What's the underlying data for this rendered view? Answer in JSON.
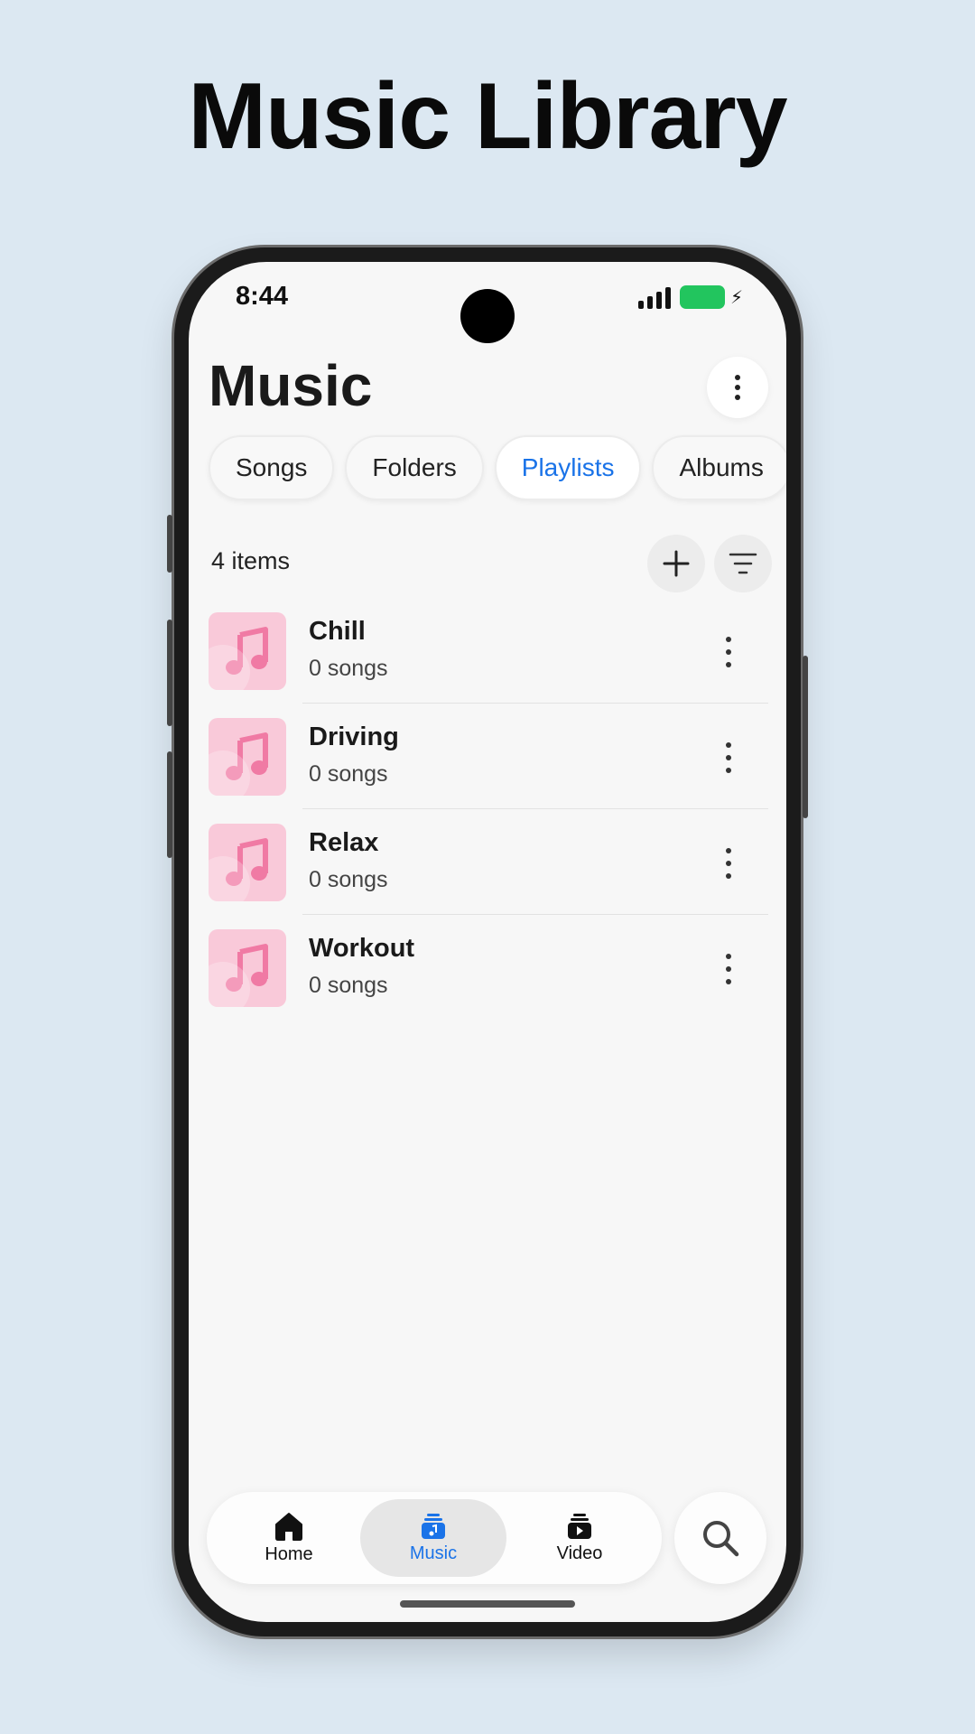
{
  "promo": {
    "title": "Music Library"
  },
  "status_bar": {
    "time": "8:44"
  },
  "header": {
    "title": "Music"
  },
  "tabs": [
    {
      "label": "Songs"
    },
    {
      "label": "Folders"
    },
    {
      "label": "Playlists",
      "active": true
    },
    {
      "label": "Albums"
    }
  ],
  "toolbar": {
    "count_label": "4 items"
  },
  "playlists": [
    {
      "name": "Chill",
      "subtitle": "0 songs"
    },
    {
      "name": "Driving",
      "subtitle": "0 songs"
    },
    {
      "name": "Relax",
      "subtitle": "0 songs"
    },
    {
      "name": "Workout",
      "subtitle": "0 songs"
    }
  ],
  "bottom_nav": {
    "items": [
      {
        "label": "Home",
        "icon": "home-icon"
      },
      {
        "label": "Music",
        "icon": "music-library-icon",
        "active": true
      },
      {
        "label": "Video",
        "icon": "video-library-icon"
      }
    ]
  },
  "colors": {
    "accent": "#1a73e8",
    "battery": "#22c55e",
    "thumb": "#f9c9d9",
    "thumb_note": "#f07aa4",
    "background": "#dce8f2"
  }
}
